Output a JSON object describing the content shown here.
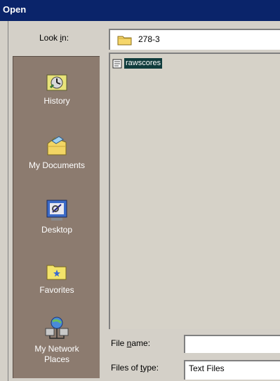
{
  "dialog": {
    "title": "Open"
  },
  "look_in": {
    "label_pre": "Look ",
    "label_key": "i",
    "label_post": "n:",
    "value": "278-3"
  },
  "places": [
    {
      "label": "History",
      "icon": "history-icon"
    },
    {
      "label": "My Documents",
      "icon": "my-documents-icon"
    },
    {
      "label": "Desktop",
      "icon": "desktop-icon"
    },
    {
      "label": "Favorites",
      "icon": "favorites-icon"
    },
    {
      "label": "My Network Places",
      "icon": "network-places-icon"
    }
  ],
  "files": [
    {
      "name": "rawscores",
      "icon": "text-file-icon",
      "selected": true
    }
  ],
  "file_name": {
    "label_pre": "File ",
    "label_key": "n",
    "label_post": "ame:",
    "value": ""
  },
  "file_type": {
    "label_pre": "Files of ",
    "label_key": "t",
    "label_post": "ype:",
    "value": "Text Files"
  }
}
